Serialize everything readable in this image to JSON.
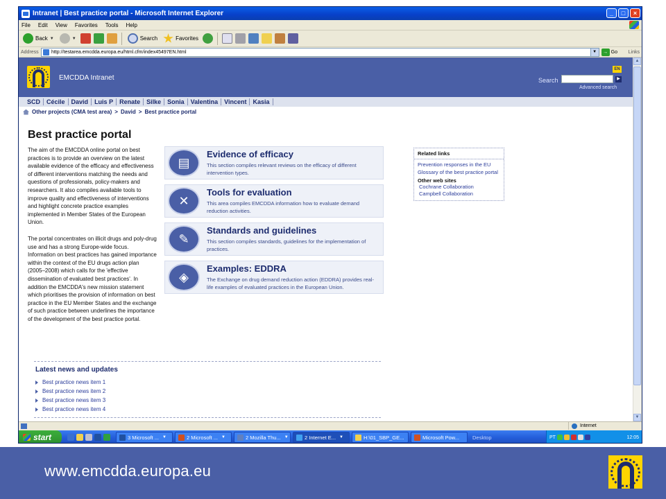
{
  "browser": {
    "title": "Intranet | Best practice portal - Microsoft Internet Explorer",
    "menu": [
      "File",
      "Edit",
      "View",
      "Favorites",
      "Tools",
      "Help"
    ],
    "toolbar": {
      "back": "Back",
      "search": "Search",
      "favorites": "Favorites"
    },
    "address_label": "Address",
    "url": "http://testarea.emcdda.europa.eu/html.cfm/index45497EN.html",
    "go": "Go",
    "links": "Links",
    "status_zone": "Internet"
  },
  "site": {
    "name": "EMCDDA Intranet",
    "lang": "EN",
    "search_label": "Search",
    "advanced_search": "Advanced search",
    "user_tabs": [
      "SCD",
      "Cécile",
      "David",
      "Luis P",
      "Renate",
      "Silke",
      "Sonia",
      "Valentina",
      "Vincent",
      "Kasia"
    ],
    "breadcrumb": [
      "Other projects (CMA test area)",
      ">",
      "David",
      ">",
      "Best practice portal"
    ]
  },
  "page": {
    "title": "Best practice portal",
    "intro_p1": "The aim of the EMCDDA online portal on best practices is to provide an overview on the latest available evidence of the efficacy and effectiveness of different interventions matching the needs and questions of professionals, policy-makers and researchers. It also compiles available tools to improve quality and effectiveness of interventions and highlight concrete practice examples implemented in Member States of the European Union.",
    "intro_p2": "The portal concentrates on illicit drugs and poly-drug use and has a strong Europe-wide focus. Information on best practices has gained importance within the context of the EU drugs action plan (2005–2008) which calls for the 'effective dissemination of evaluated best practices'. In addition the EMCDDA's new mission statement which prioritises the provision of information on best practice in the EU Member States and the exchange of such practice between underlines the importance of the development of the best practice portal.",
    "sections": [
      {
        "title": "Evidence of efficacy",
        "desc": "This section compiles relevant reviews on the efficacy of different intervention types.",
        "icon": "documents-icon"
      },
      {
        "title": "Tools for evaluation",
        "desc": "This area compiles EMCDDA information how to evaluate demand reduction activities.",
        "icon": "tools-icon"
      },
      {
        "title": "Standards and guidelines",
        "desc": "This section compiles standards, guidelines for the implementation of practices.",
        "icon": "pen-icon"
      },
      {
        "title": "Examples: EDDRA",
        "desc": "The Exchange on drug demand reduction action (EDDRA) provides real-life examples of evaluated practices in the European Union.",
        "icon": "europe-map-icon"
      }
    ],
    "related": {
      "heading": "Related links",
      "links": [
        "Prevention responses in the EU",
        "Glossary of the best practice portal"
      ],
      "other_heading": "Other web sites",
      "other_links": [
        "Cochrane Collaboration",
        "Campbell Collaboration"
      ]
    },
    "news": {
      "heading": "Latest news and updates",
      "items": [
        "Best practice news item 1",
        "Best practice news item 2",
        "Best practice news item 3",
        "Best practice news item 4"
      ]
    }
  },
  "taskbar": {
    "start": "start",
    "tasks": [
      "3 Microsoft ...",
      "2 Microsoft ...",
      "2 Mozilla Thu...",
      "2 Internet E...",
      "H:\\01_SBP_GE...",
      "Microsoft Pow..."
    ],
    "desktop": "Desktop",
    "tray_lang": "PT",
    "clock": "12:05"
  },
  "footer": {
    "url": "www.emcdda.europa.eu"
  },
  "colors": {
    "brand_blue": "#4a5fa6",
    "brand_yellow": "#ffd400",
    "link_blue": "#2a3c9a"
  }
}
